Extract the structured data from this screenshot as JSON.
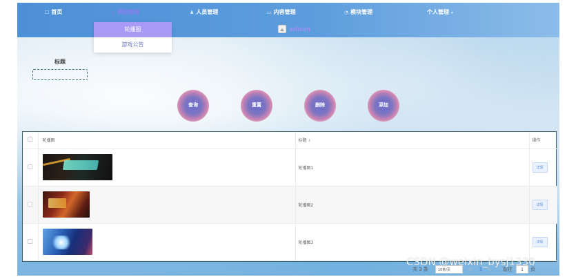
{
  "nav": {
    "items": [
      {
        "label": "首页",
        "icon": "home-icon"
      },
      {
        "label": "网站管理",
        "icon": "site-icon"
      },
      {
        "label": "人员管理",
        "icon": "user-icon"
      },
      {
        "label": "内容管理",
        "icon": "content-icon"
      },
      {
        "label": "模块管理",
        "icon": "module-icon"
      },
      {
        "label": "个人管理",
        "icon": "person-icon"
      }
    ],
    "active_index": 1,
    "active_color": "#8a7ff0"
  },
  "user": {
    "name": "admin",
    "icon": "avatar-icon",
    "color": "#9a8ff2"
  },
  "dropdown": {
    "items": [
      {
        "label": "轮播图",
        "active": true
      },
      {
        "label": "游戏公告",
        "active": false
      }
    ],
    "active_color": "#a89af5"
  },
  "search": {
    "label": "标题",
    "value": ""
  },
  "buttons": {
    "query": "查询",
    "reset": "重置",
    "delete": "删除",
    "add": "添加"
  },
  "table": {
    "columns": [
      "轮播图",
      "标题",
      "操作"
    ],
    "rows": [
      {
        "title": "轮播图1",
        "image": "carousel-thumbnail-escape-room",
        "action": "详情"
      },
      {
        "title": "轮播图2",
        "image": "carousel-thumbnail-fantasy",
        "action": "详情"
      },
      {
        "title": "轮播图3",
        "image": "carousel-thumbnail-fairy",
        "action": "详情"
      }
    ]
  },
  "pagination": {
    "total": "共 3 条",
    "page_size": "10条/页",
    "prev": "<",
    "current": "1",
    "next": ">",
    "goto_label": "前往",
    "goto_value": "1",
    "page_suffix": "页"
  },
  "watermark": "CSDN @weixin_bysj1330"
}
